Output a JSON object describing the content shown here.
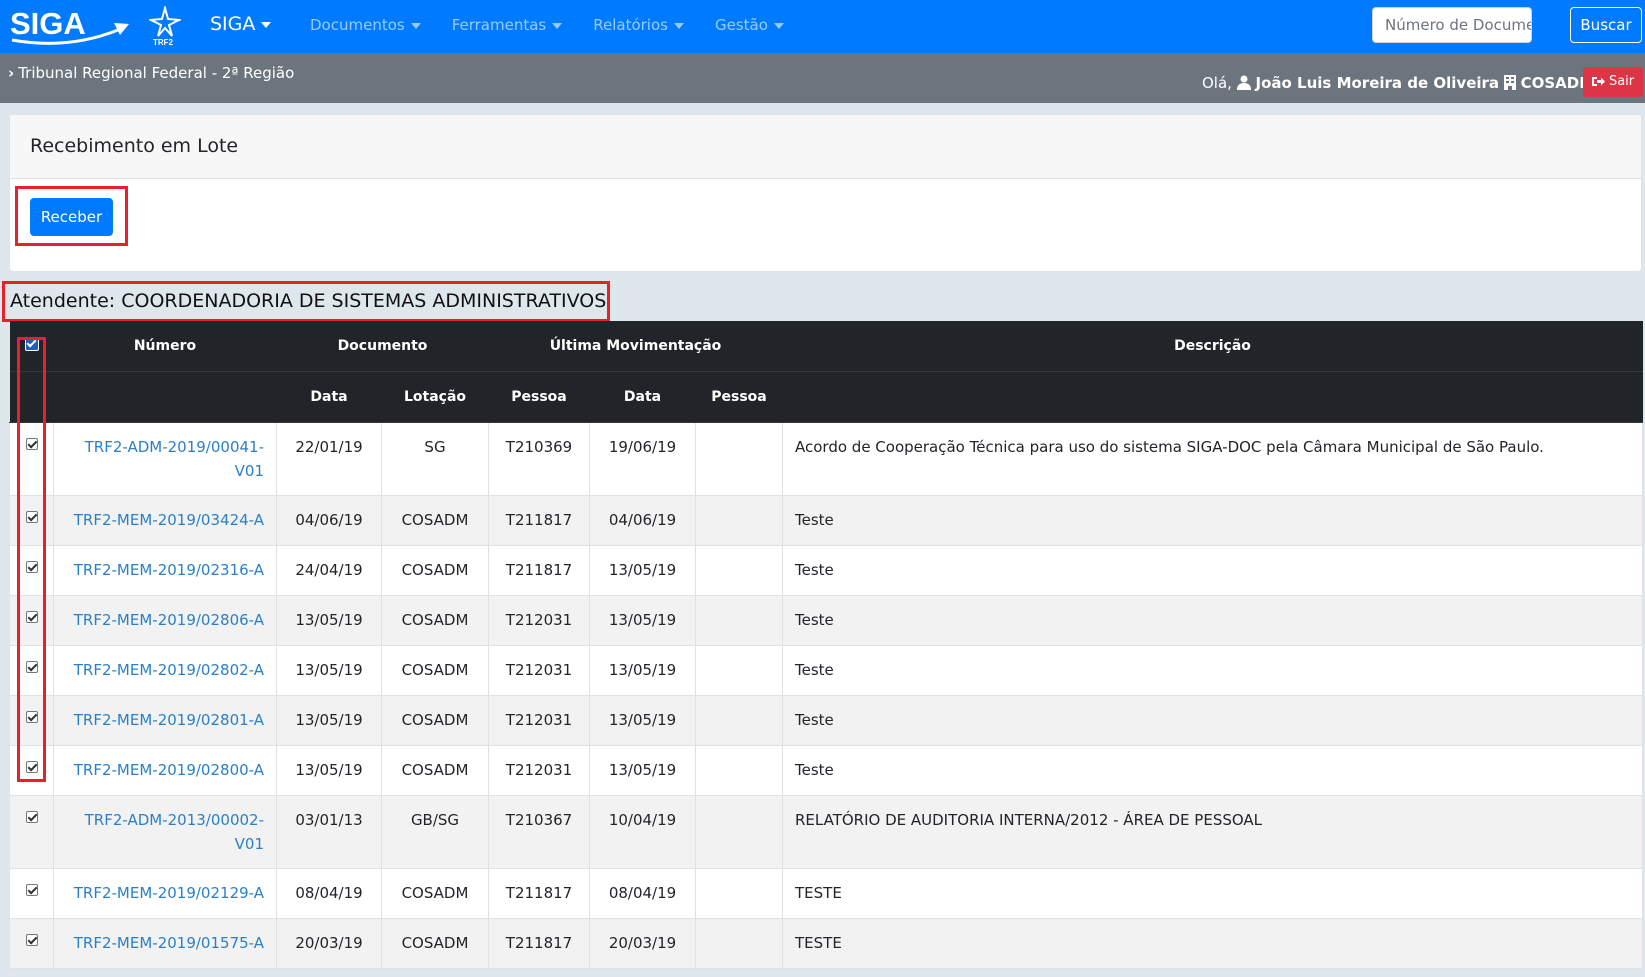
{
  "navbar": {
    "logo_text": "SIGA",
    "logo_sub": "TRF2",
    "brand": "SIGA",
    "menu": [
      "Documentos",
      "Ferramentas",
      "Relatórios",
      "Gestão"
    ],
    "search_placeholder": "Número de Documento",
    "search_button": "Buscar"
  },
  "subbar": {
    "org": "Tribunal Regional Federal - 2ª Região",
    "greeting": "Olá,",
    "user_name": "João Luis Moreira de Oliveira",
    "unit": "COSADM",
    "logout": "Sair"
  },
  "card": {
    "title": "Recebimento em Lote",
    "receive_button": "Receber"
  },
  "atendente": "Atendente: COORDENADORIA DE SISTEMAS ADMINISTRATIVOS",
  "table": {
    "headers": {
      "numero": "Número",
      "documento": "Documento",
      "ultima": "Última Movimentação",
      "descricao": "Descrição",
      "data1": "Data",
      "lotacao": "Lotação",
      "pessoa1": "Pessoa",
      "data2": "Data",
      "pessoa2": "Pessoa"
    },
    "rows": [
      {
        "numero": "TRF2-ADM-2019/00041-V01",
        "data": "22/01/19",
        "lotacao": "SG",
        "pessoa": "T210369",
        "mov_data": "19/06/19",
        "mov_pessoa": "",
        "descricao": "Acordo de Cooperação Técnica para uso do sistema SIGA-DOC pela Câmara Municipal de São Paulo."
      },
      {
        "numero": "TRF2-MEM-2019/03424-A",
        "data": "04/06/19",
        "lotacao": "COSADM",
        "pessoa": "T211817",
        "mov_data": "04/06/19",
        "mov_pessoa": "",
        "descricao": "Teste"
      },
      {
        "numero": "TRF2-MEM-2019/02316-A",
        "data": "24/04/19",
        "lotacao": "COSADM",
        "pessoa": "T211817",
        "mov_data": "13/05/19",
        "mov_pessoa": "",
        "descricao": "Teste"
      },
      {
        "numero": "TRF2-MEM-2019/02806-A",
        "data": "13/05/19",
        "lotacao": "COSADM",
        "pessoa": "T212031",
        "mov_data": "13/05/19",
        "mov_pessoa": "",
        "descricao": "Teste"
      },
      {
        "numero": "TRF2-MEM-2019/02802-A",
        "data": "13/05/19",
        "lotacao": "COSADM",
        "pessoa": "T212031",
        "mov_data": "13/05/19",
        "mov_pessoa": "",
        "descricao": "Teste"
      },
      {
        "numero": "TRF2-MEM-2019/02801-A",
        "data": "13/05/19",
        "lotacao": "COSADM",
        "pessoa": "T212031",
        "mov_data": "13/05/19",
        "mov_pessoa": "",
        "descricao": "Teste"
      },
      {
        "numero": "TRF2-MEM-2019/02800-A",
        "data": "13/05/19",
        "lotacao": "COSADM",
        "pessoa": "T212031",
        "mov_data": "13/05/19",
        "mov_pessoa": "",
        "descricao": "Teste"
      },
      {
        "numero": "TRF2-ADM-2013/00002-V01",
        "data": "03/01/13",
        "lotacao": "GB/SG",
        "pessoa": "T210367",
        "mov_data": "10/04/19",
        "mov_pessoa": "",
        "descricao": "RELATÓRIO DE AUDITORIA INTERNA/2012 - ÁREA DE PESSOAL"
      },
      {
        "numero": "TRF2-MEM-2019/02129-A",
        "data": "08/04/19",
        "lotacao": "COSADM",
        "pessoa": "T211817",
        "mov_data": "08/04/19",
        "mov_pessoa": "",
        "descricao": "TESTE"
      },
      {
        "numero": "TRF2-MEM-2019/01575-A",
        "data": "20/03/19",
        "lotacao": "COSADM",
        "pessoa": "T211817",
        "mov_data": "20/03/19",
        "mov_pessoa": "",
        "descricao": "TESTE"
      }
    ]
  },
  "colors": {
    "primary": "#007bff",
    "secondary_bar": "#6c757d",
    "danger": "#dc3545",
    "table_header": "#212529",
    "link": "#2a80c8",
    "highlight": "#e8202a"
  }
}
